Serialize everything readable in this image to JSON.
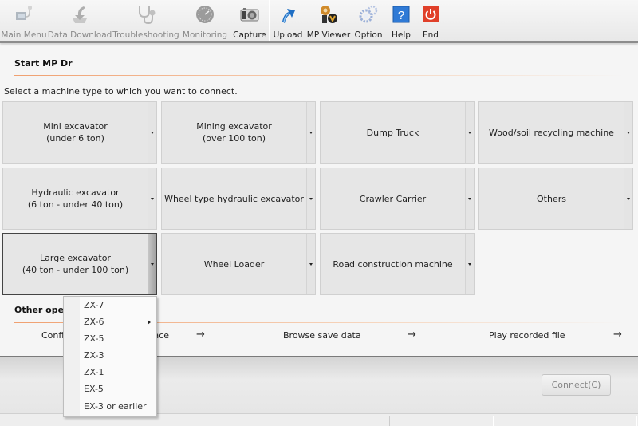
{
  "toolbar": {
    "items": [
      {
        "label": "Main Menu",
        "icon": "main-menu-icon",
        "enabled": false
      },
      {
        "label": "Data Download",
        "icon": "data-download-icon",
        "enabled": false
      },
      {
        "label": "Troubleshooting",
        "icon": "stethoscope-icon",
        "enabled": false
      },
      {
        "label": "Monitoring",
        "icon": "gauge-icon",
        "enabled": false
      },
      {
        "label": "Capture",
        "icon": "camera-icon",
        "enabled": true
      },
      {
        "label": "Upload",
        "icon": "upload-arrow-icon",
        "enabled": true
      },
      {
        "label": "MP Viewer",
        "icon": "mp-viewer-icon",
        "enabled": true
      },
      {
        "label": "Option",
        "icon": "gears-icon",
        "enabled": true
      },
      {
        "label": "Help",
        "icon": "help-icon",
        "enabled": true
      },
      {
        "label": "End",
        "icon": "power-icon",
        "enabled": true
      }
    ]
  },
  "start": {
    "title": "Start MP Dr",
    "prompt": "Select a machine type to which you want to connect."
  },
  "machines": [
    {
      "line1": "Mini excavator",
      "line2": "(under 6 ton)"
    },
    {
      "line1": "Mining excavator",
      "line2": "(over 100 ton)"
    },
    {
      "line1": "Dump Truck",
      "line2": ""
    },
    {
      "line1": "Wood/soil recycling machine",
      "line2": ""
    },
    {
      "line1": "Hydraulic excavator",
      "line2": "(6 ton - under 40 ton)"
    },
    {
      "line1": "Wheel type hydraulic excavator",
      "line2": ""
    },
    {
      "line1": "Crawler Carrier",
      "line2": ""
    },
    {
      "line1": "Others",
      "line2": ""
    },
    {
      "line1": "Large excavator",
      "line2": "(40 ton - under 100 ton)"
    },
    {
      "line1": "Wheel Loader",
      "line2": ""
    },
    {
      "line1": "Road construction machine",
      "line2": ""
    }
  ],
  "other_ops": {
    "title": "Other operations",
    "items": [
      {
        "label": "Confirm connection interface"
      },
      {
        "label": "Browse save data"
      },
      {
        "label": "Play recorded file"
      }
    ],
    "arrow": "→"
  },
  "dropdown": {
    "items": [
      {
        "label": "ZX-7",
        "has_submenu": false
      },
      {
        "label": "ZX-6",
        "has_submenu": true
      },
      {
        "label": "ZX-5",
        "has_submenu": false
      },
      {
        "label": "ZX-3",
        "has_submenu": false
      },
      {
        "label": "ZX-1",
        "has_submenu": false
      },
      {
        "label": "EX-5",
        "has_submenu": false
      },
      {
        "label": "EX-3 or earlier",
        "has_submenu": false
      }
    ]
  },
  "footer": {
    "connect_label": "Connect(",
    "connect_key": "C",
    "connect_close": ")"
  }
}
